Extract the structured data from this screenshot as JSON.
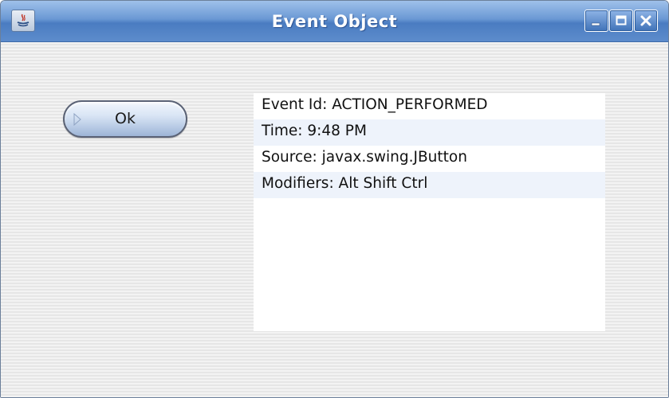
{
  "window": {
    "title": "Event Object",
    "controls": {
      "minimize": "minimize-icon",
      "maximize": "maximize-icon",
      "close": "close-icon"
    }
  },
  "form": {
    "ok_button_label": "Ok"
  },
  "event_list": {
    "items": [
      {
        "label": "Event Id: ACTION_PERFORMED"
      },
      {
        "label": "Time: 9:48 PM"
      },
      {
        "label": "Source: javax.swing.JButton"
      },
      {
        "label": "Modifiers: Alt Shift Ctrl"
      }
    ]
  },
  "colors": {
    "titlebar": "#5d8ccc",
    "list_alt_row": "#eef3fb",
    "button_face": "#d9e5f5"
  }
}
